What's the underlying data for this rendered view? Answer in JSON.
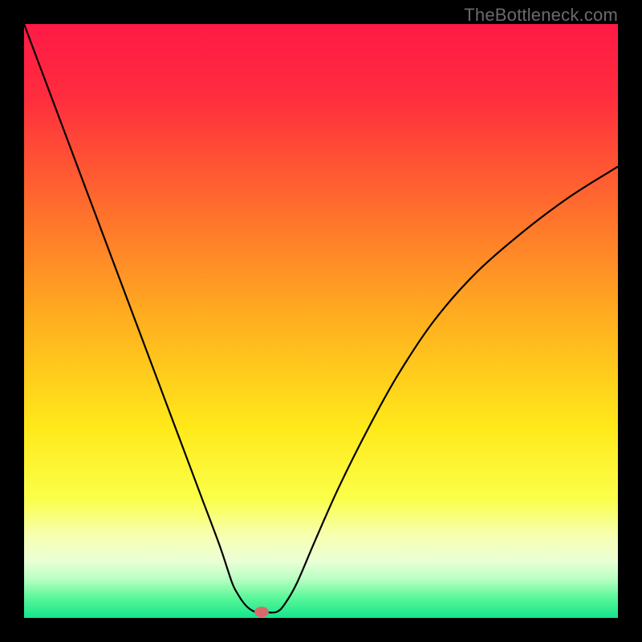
{
  "watermark": "TheBottleneck.com",
  "chart_data": {
    "type": "line",
    "title": "",
    "xlabel": "",
    "ylabel": "",
    "xlim": [
      0,
      100
    ],
    "ylim": [
      0,
      100
    ],
    "background_gradient": {
      "stops": [
        {
          "offset": 0.0,
          "color": "#ff1a46"
        },
        {
          "offset": 0.12,
          "color": "#ff2c3e"
        },
        {
          "offset": 0.3,
          "color": "#ff6a2e"
        },
        {
          "offset": 0.5,
          "color": "#ffb01f"
        },
        {
          "offset": 0.68,
          "color": "#ffe91a"
        },
        {
          "offset": 0.8,
          "color": "#fbff4a"
        },
        {
          "offset": 0.86,
          "color": "#f7ffb0"
        },
        {
          "offset": 0.905,
          "color": "#eaffd6"
        },
        {
          "offset": 0.935,
          "color": "#b8ffc2"
        },
        {
          "offset": 0.965,
          "color": "#5cf79a"
        },
        {
          "offset": 1.0,
          "color": "#14e58b"
        }
      ]
    },
    "series": [
      {
        "name": "bottleneck-curve",
        "color": "#000000",
        "width": 2.2,
        "x": [
          0,
          3,
          6,
          9,
          12,
          15,
          18,
          21,
          24,
          27,
          30,
          33,
          35,
          36,
          37,
          38,
          39,
          40,
          42.5,
          44,
          46,
          49,
          53,
          58,
          63,
          69,
          76,
          84,
          92,
          100
        ],
        "values": [
          100,
          92,
          84,
          76,
          68,
          60,
          52,
          44,
          36,
          28,
          20,
          12,
          6,
          4,
          2.5,
          1.5,
          1.0,
          1.0,
          1.0,
          2.5,
          6,
          13,
          22,
          32,
          41,
          50,
          58,
          65,
          71,
          76
        ]
      }
    ],
    "marker": {
      "name": "optimal-point",
      "x": 40,
      "y": 1.0,
      "rx": 1.2,
      "ry": 0.9,
      "color": "#d86a6a"
    }
  }
}
